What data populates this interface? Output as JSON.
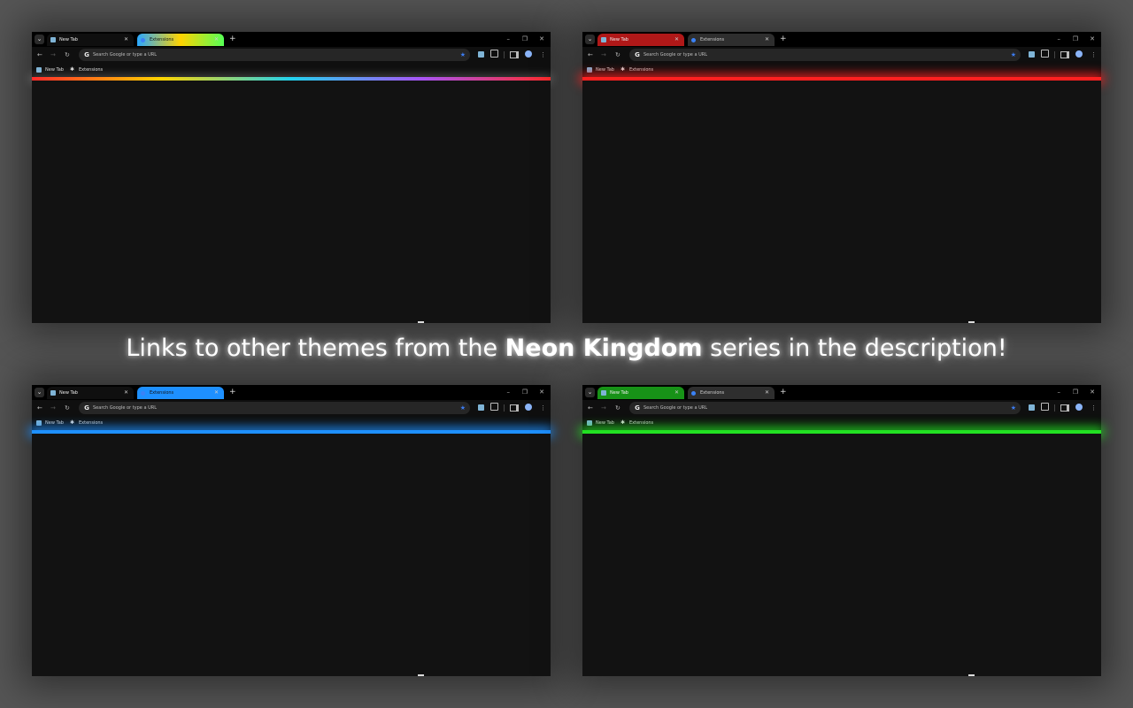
{
  "headline": {
    "prefix": "Links to other themes from the ",
    "bold": "Neon Kingdom",
    "suffix": " series in the description!"
  },
  "browser": {
    "tabs": [
      "New Tab",
      "Extensions"
    ],
    "omnibox_placeholder": "Search Google or type a URL",
    "bookmarks": [
      "New Tab",
      "Extensions"
    ],
    "icons": {
      "tab_search": "chevron-down-icon",
      "back": "back-arrow-icon",
      "forward": "forward-arrow-icon",
      "reload": "reload-icon",
      "google": "google-icon",
      "bookmark_star": "star-icon",
      "extensions": "puzzle-icon",
      "side_panel": "side-panel-icon",
      "profile": "avatar-icon",
      "menu": "kebab-menu-icon"
    }
  },
  "themes": [
    {
      "name": "rainbow",
      "accent": [
        "#ff2a2a",
        "#ffd400",
        "#22d3ee",
        "#a855f7",
        "#ff2a2a"
      ]
    },
    {
      "name": "red",
      "accent": "#ff2020"
    },
    {
      "name": "blue",
      "accent": "#1e90ff"
    },
    {
      "name": "green",
      "accent": "#22e022"
    }
  ]
}
